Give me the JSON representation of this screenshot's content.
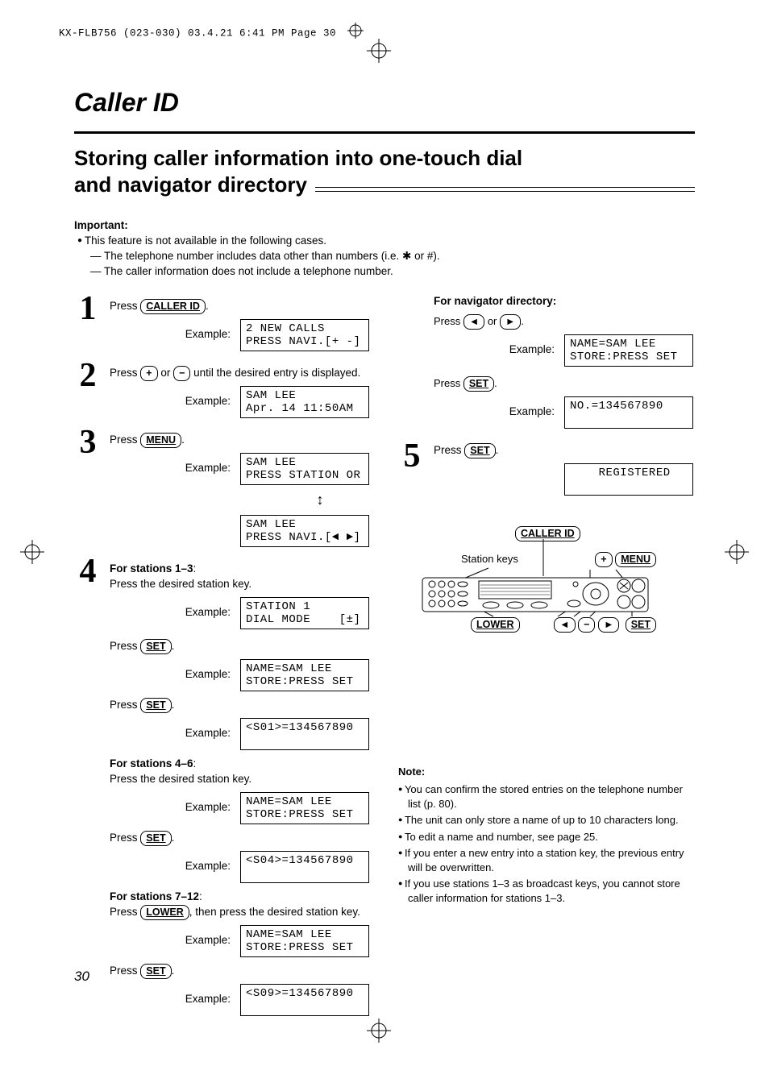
{
  "running_head": "KX-FLB756 (023-030)  03.4.21  6:41 PM  Page 30",
  "page_title": "Caller ID",
  "section_title_line1": "Storing caller information into one-touch dial",
  "section_title_line2": "and navigator directory",
  "important": {
    "label": "Important:",
    "bullet": "This feature is not available in the following cases.",
    "dash1_pre": "The telephone number includes data other than numbers (i.e. ",
    "dash1_sym": "✱",
    "dash1_post": " or #).",
    "dash2": "The caller information does not include a telephone number."
  },
  "keys": {
    "caller_id": "CALLER ID",
    "plus": "+",
    "minus": "−",
    "menu": "MENU",
    "set": "SET",
    "lower": "LOWER",
    "left": "◄",
    "right": "►"
  },
  "example_label": "Example:",
  "steps": {
    "s1": {
      "num": "1",
      "text_pre": "Press ",
      "text_post": ".",
      "lcd": "2 NEW CALLS\nPRESS NAVI.[+ -]"
    },
    "s2": {
      "num": "2",
      "text_pre": "Press ",
      "text_mid": " or ",
      "text_post": " until the desired entry is displayed.",
      "lcd": "SAM LEE\nApr. 14 11:50AM"
    },
    "s3": {
      "num": "3",
      "text_pre": "Press ",
      "text_post": ".",
      "lcd_a": "SAM LEE\nPRESS STATION OR",
      "lcd_b": "SAM LEE\nPRESS NAVI.[◄ ►]"
    },
    "s4": {
      "num": "4",
      "hdr1": "For stations 1–3",
      "body1": "Press the desired station key.",
      "lcd1": "STATION 1\nDIAL MODE    [±]",
      "press_set": "Press ",
      "lcd2": "NAME=SAM LEE\nSTORE:PRESS SET",
      "lcd3": "<S01>=134567890\n ",
      "hdr2": "For stations 4–6",
      "body2": "Press the desired station key.",
      "lcd4": "NAME=SAM LEE\nSTORE:PRESS SET",
      "lcd5": "<S04>=134567890\n ",
      "hdr3": "For stations 7–12",
      "body3_pre": "Press ",
      "body3_post": ", then press the desired station key.",
      "lcd6": "NAME=SAM LEE\nSTORE:PRESS SET",
      "lcd7": "<S09>=134567890\n "
    },
    "nav": {
      "hdr": "For navigator directory:",
      "press_arrow_pre": "Press ",
      "press_arrow_mid": " or ",
      "press_arrow_post": ".",
      "lcd1": "NAME=SAM LEE\nSTORE:PRESS SET",
      "press_set": "Press ",
      "lcd2": "NO.=134567890\n "
    },
    "s5": {
      "num": "5",
      "text_pre": "Press ",
      "text_post": ".",
      "lcd": "    REGISTERED\n "
    }
  },
  "panel": {
    "caller_id": "CALLER ID",
    "station_keys": "Station keys",
    "plus": "+",
    "menu": "MENU",
    "lower": "LOWER",
    "minus": "−",
    "left": "◄",
    "right": "►",
    "set": "SET"
  },
  "note": {
    "label": "Note:",
    "n1": "You can confirm the stored entries on the telephone number list (p. 80).",
    "n2": "The unit can only store a name of up to 10 characters long.",
    "n3": "To edit a name and number, see page 25.",
    "n4": "If you enter a new entry into a station key, the previous entry will be overwritten.",
    "n5": "If you use stations 1–3 as broadcast keys, you cannot store caller information for stations 1–3."
  },
  "page_number": "30"
}
